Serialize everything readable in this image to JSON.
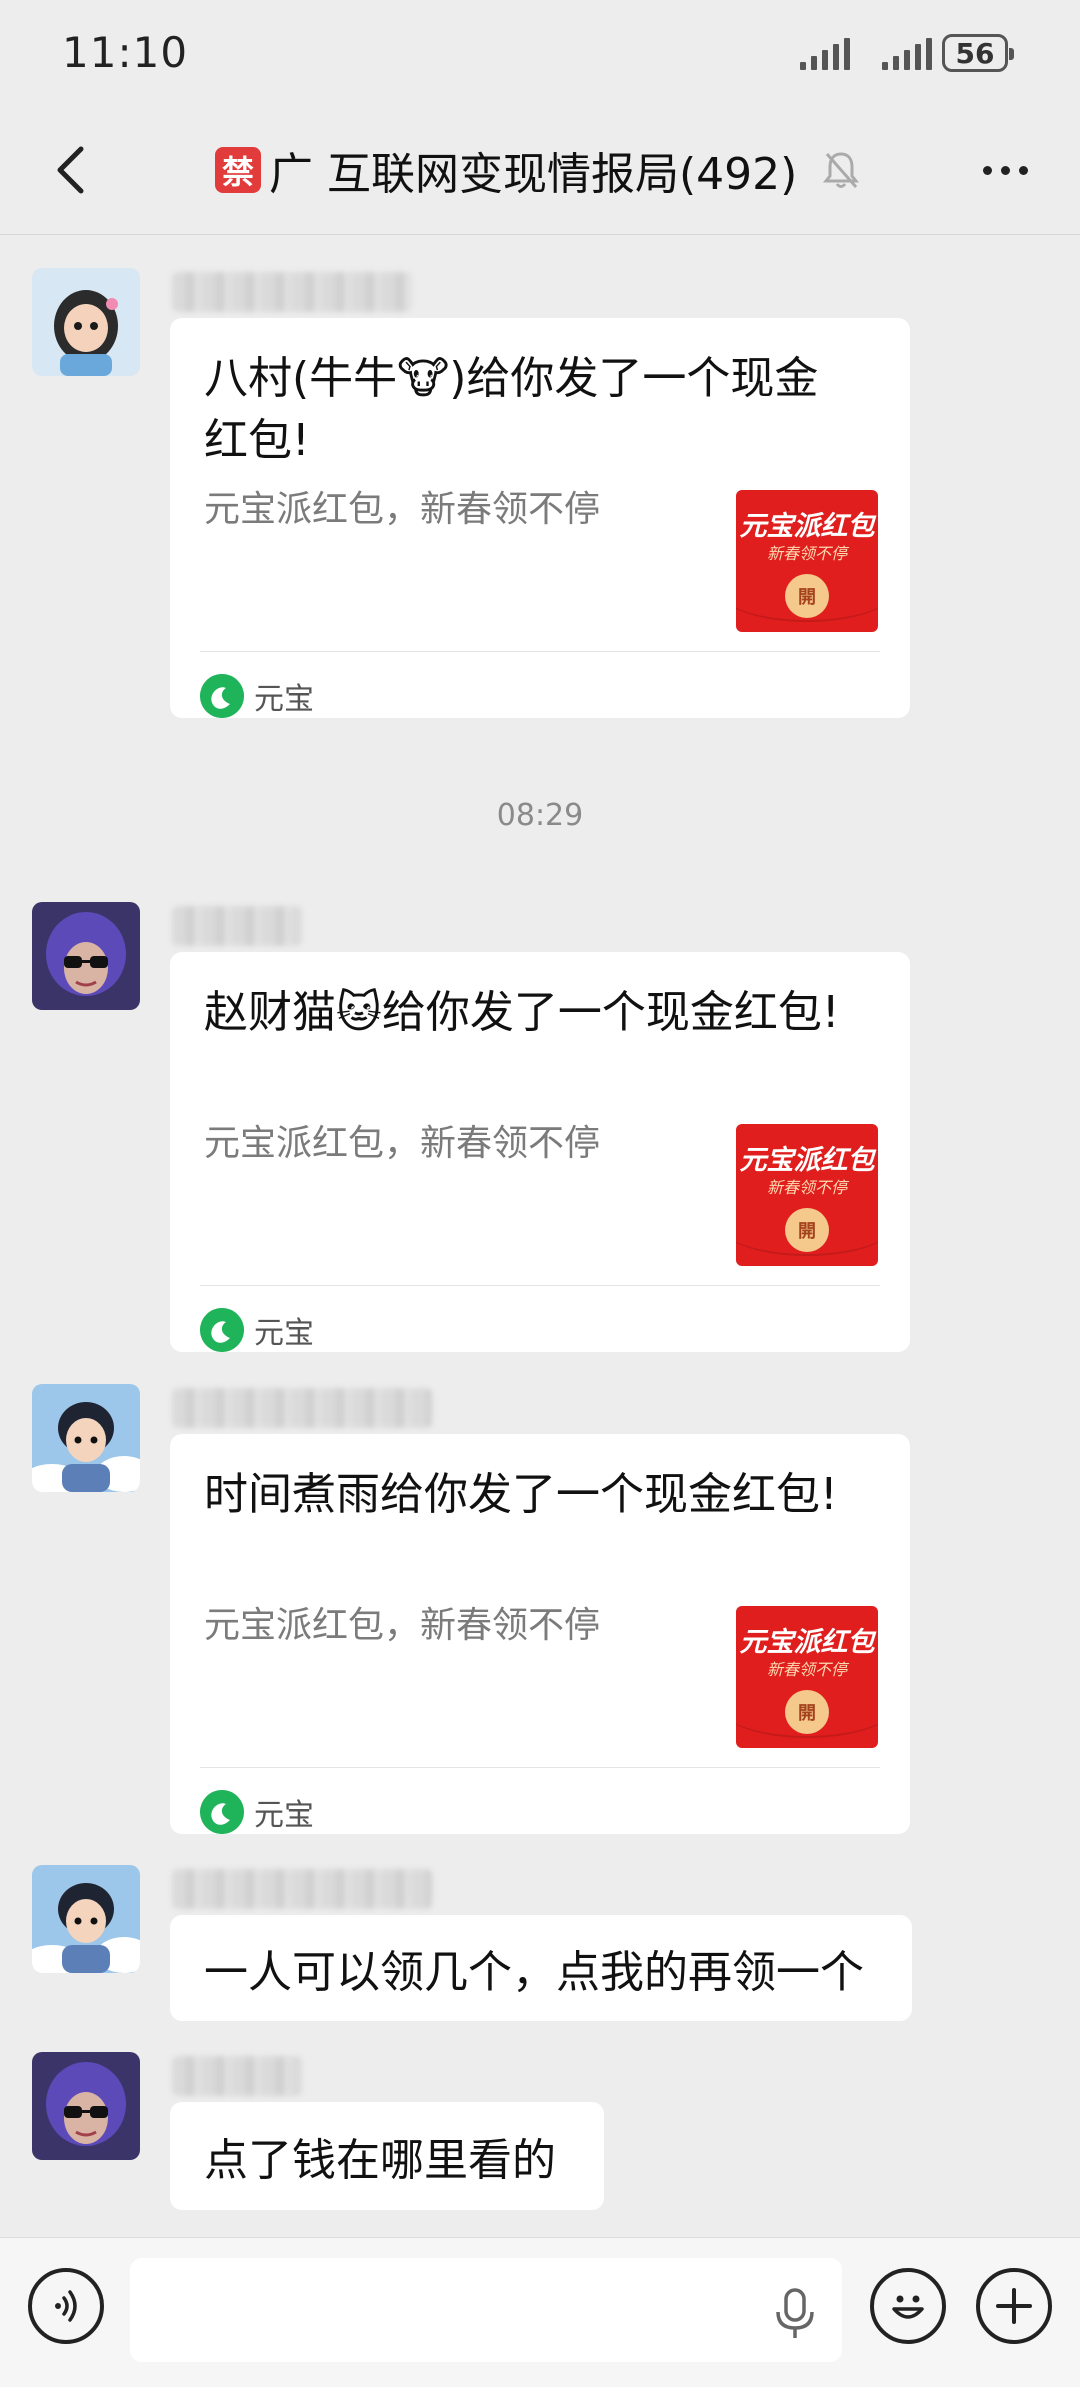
{
  "status_bar": {
    "time": "11:10",
    "battery": "56"
  },
  "header": {
    "badge": "禁",
    "title": "广 互联网变现情报局(492)"
  },
  "messages": [
    {
      "type": "red_packet",
      "title": "八村(牛牛🐮)给你发了一个现金红包!",
      "subtitle": "元宝派红包，新春领不停",
      "envelope_title": "元宝派红包",
      "envelope_subtitle": "新春领不停",
      "envelope_coin": "開",
      "source": "元宝"
    },
    {
      "type": "red_packet",
      "title": "赵财猫🐱给你发了一个现金红包!",
      "subtitle": "元宝派红包，新春领不停",
      "envelope_title": "元宝派红包",
      "envelope_subtitle": "新春领不停",
      "envelope_coin": "開",
      "source": "元宝"
    },
    {
      "type": "red_packet",
      "title": "时间煮雨给你发了一个现金红包!",
      "subtitle": "元宝派红包，新春领不停",
      "envelope_title": "元宝派红包",
      "envelope_subtitle": "新春领不停",
      "envelope_coin": "開",
      "source": "元宝"
    },
    {
      "type": "text",
      "text": "一人可以领几个，点我的再领一个"
    },
    {
      "type": "text",
      "text": "点了钱在哪里看的"
    }
  ],
  "time_divider": "08:29",
  "colors": {
    "background": "#ededed",
    "red_packet": "#e01e1e",
    "yuanbao_green": "#1fb45a",
    "ban_badge": "#e23b3b"
  },
  "icons": {
    "back": "chevron-left-icon",
    "mute": "bell-off-icon",
    "more": "more-dots-icon",
    "voice": "voice-icon",
    "mic": "mic-icon",
    "emoji": "emoji-icon",
    "plus": "plus-icon"
  }
}
